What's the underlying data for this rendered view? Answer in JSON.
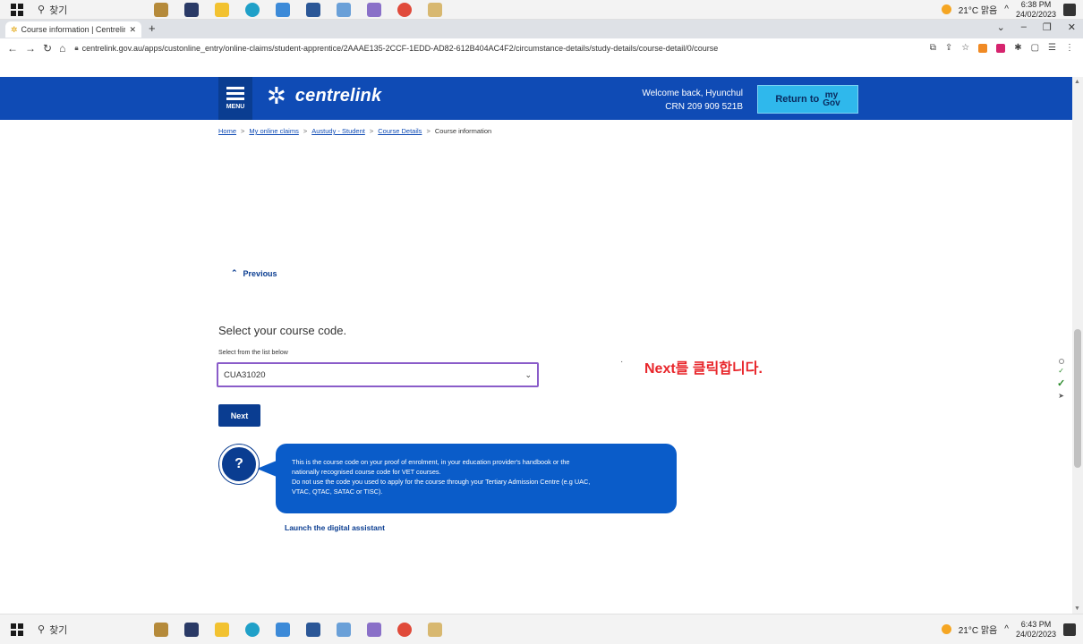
{
  "taskbar_top": {
    "search_label": "찾기",
    "weather": "21°C 맑음",
    "time": "6:38 PM",
    "date": "24/02/2023"
  },
  "taskbar_bottom": {
    "search_label": "찾기",
    "weather": "21°C 맑음",
    "time": "6:43 PM",
    "date": "24/02/2023"
  },
  "browser": {
    "tab_title": "Course information | Centrelink",
    "url": "centrelink.gov.au/apps/custonline_entry/online-claims/student-apprentice/2AAAE135-2CCF-1EDD-AD82-612B404AC4F2/circumstance-details/study-details/course-detail/0/course"
  },
  "header": {
    "menu_label": "MENU",
    "logo_text": "centrelink",
    "welcome_line1": "Welcome back, Hyunchul",
    "welcome_line2": "CRN 209 909 521B",
    "return_label": "Return to",
    "mygov_top": "my",
    "mygov_bottom": "Gov"
  },
  "breadcrumb": {
    "items": [
      "Home",
      "My online claims",
      "Austudy - Student",
      "Course Details"
    ],
    "current": "Course information",
    "separator": ">"
  },
  "main": {
    "previous_label": "Previous",
    "question": "Select your course code.",
    "select_label": "Select from the list below",
    "selected_value": "CUA31020",
    "next_label": "Next",
    "help_lines": [
      "This is the course code on your proof of enrolment, in your education provider's handbook or the",
      "nationally recognised course code for VET courses.",
      "Do not use the code you used to apply for the course through your Tertiary Admission Centre (e.g UAC,",
      "VTAC, QTAC, SATAC or TISC)."
    ],
    "launch_assistant": "Launch the digital assistant"
  },
  "annotation": {
    "text": "Next를 클릭합니다."
  },
  "colors": {
    "header_blue": "#0f4bb5",
    "dark_blue": "#0a3d91",
    "mygov_cyan": "#2fb8ec",
    "bubble_blue": "#0a5cc9",
    "select_border": "#8a5cc9",
    "annotation_red": "#e8262b"
  }
}
